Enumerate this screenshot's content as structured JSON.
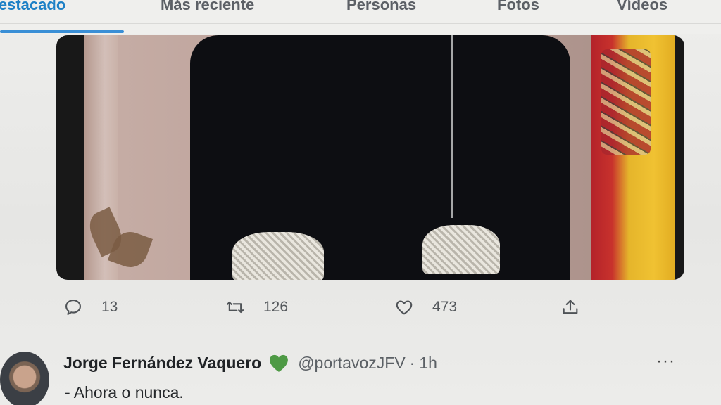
{
  "tabs": [
    {
      "label": "Destacado",
      "active": true
    },
    {
      "label": "Más reciente",
      "active": false
    },
    {
      "label": "Personas",
      "active": false
    },
    {
      "label": "Fotos",
      "active": false
    },
    {
      "label": "Vídeos",
      "active": false
    }
  ],
  "colors": {
    "accent": "#1d80c6",
    "verified_heart": "#4e9a45",
    "text_primary": "#202326",
    "text_secondary": "#5b6065"
  },
  "tweet_actions": {
    "reply": {
      "icon": "reply-icon",
      "count": "13"
    },
    "retweet": {
      "icon": "retweet-icon",
      "count": "126"
    },
    "like": {
      "icon": "heart-icon",
      "count": "473"
    },
    "share": {
      "icon": "share-icon"
    }
  },
  "next_tweet": {
    "author_name": "Jorge Fernández Vaquero",
    "badge_icon": "green-heart-icon",
    "handle": "@portavozJFV",
    "separator": "·",
    "time": "1h",
    "more_label": "···",
    "text": "- Ahora o nunca."
  }
}
